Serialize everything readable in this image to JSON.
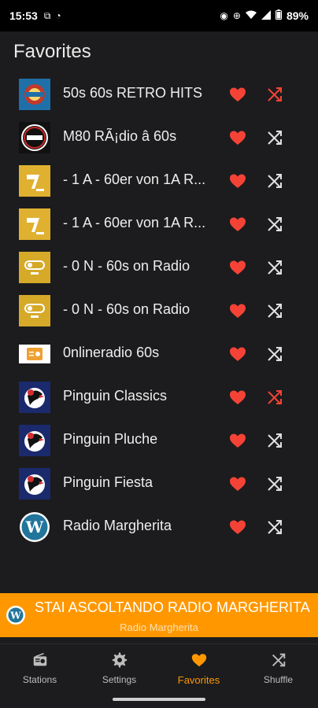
{
  "status_bar": {
    "time": "15:53",
    "battery": "89%"
  },
  "page": {
    "title": "Favorites"
  },
  "colors": {
    "accent": "#ff9800",
    "heart": "#f44336",
    "shuffle_active": "#f44336",
    "shuffle_inactive": "#e0e0e0"
  },
  "stations": [
    {
      "name": "50s 60s RETRO HITS",
      "logo_icon": "retro-hits-logo",
      "shuffle_active": true
    },
    {
      "name": "M80 RÃ¡dio â 60s",
      "logo_icon": "m80-logo",
      "shuffle_active": false
    },
    {
      "name": "- 1 A - 60er von 1A R...",
      "logo_icon": "1a-logo",
      "shuffle_active": false
    },
    {
      "name": "- 1 A - 60er von 1A R...",
      "logo_icon": "1a-logo",
      "shuffle_active": false
    },
    {
      "name": "- 0 N - 60s on Radio",
      "logo_icon": "on-radio-logo",
      "shuffle_active": false
    },
    {
      "name": "- 0 N - 60s on Radio",
      "logo_icon": "on-radio-logo",
      "shuffle_active": false
    },
    {
      "name": "0nlineradio 60s",
      "logo_icon": "radio-logo",
      "shuffle_active": false
    },
    {
      "name": "Pinguin Classics",
      "logo_icon": "pinguin-logo",
      "shuffle_active": true
    },
    {
      "name": "Pinguin Pluche",
      "logo_icon": "pinguin-logo",
      "shuffle_active": false
    },
    {
      "name": "Pinguin Fiesta",
      "logo_icon": "pinguin-logo",
      "shuffle_active": false
    },
    {
      "name": "Radio Margherita",
      "logo_icon": "wordpress-logo",
      "shuffle_active": false
    }
  ],
  "now_playing": {
    "title": "STAI ASCOLTANDO RADIO MARGHERITA",
    "subtitle": "Radio Margherita"
  },
  "bottom_nav": {
    "items": [
      {
        "label": "Stations",
        "icon": "radio-icon"
      },
      {
        "label": "Settings",
        "icon": "gear-icon"
      },
      {
        "label": "Favorites",
        "icon": "heart-icon",
        "active": true
      },
      {
        "label": "Shuffle",
        "icon": "shuffle-icon"
      }
    ]
  }
}
